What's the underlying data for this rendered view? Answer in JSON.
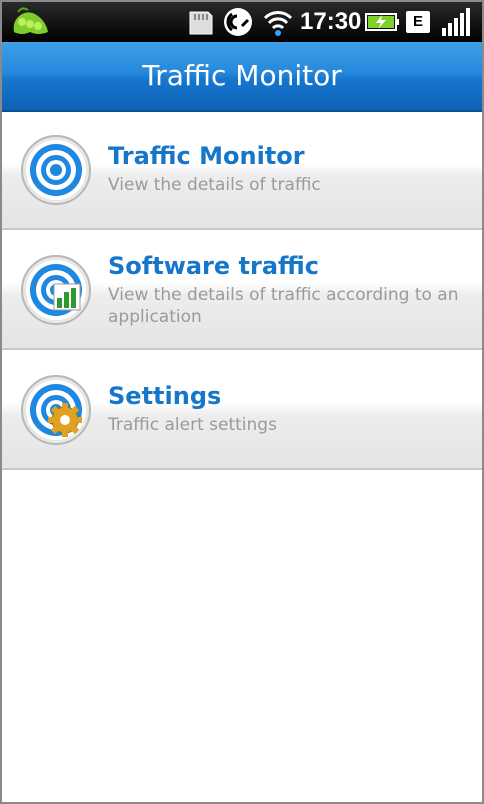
{
  "status_bar": {
    "time": "17:30",
    "network_type": "E",
    "icons": [
      "app-notification-icon",
      "sd-card-icon",
      "nfc-icon",
      "wifi-icon",
      "battery-charging-icon",
      "signal-bars-icon"
    ]
  },
  "title_bar": {
    "title": "Traffic Monitor"
  },
  "menu": {
    "items": [
      {
        "title": "Traffic Monitor",
        "subtitle": "View the details of traffic",
        "icon": "target-icon"
      },
      {
        "title": "Software traffic",
        "subtitle": "View the details of traffic according to an application",
        "icon": "target-chart-icon"
      },
      {
        "title": "Settings",
        "subtitle": "Traffic alert settings",
        "icon": "target-gear-icon"
      }
    ]
  },
  "colors": {
    "title_bar": "#1a7ed4",
    "item_title": "#1676c9",
    "item_subtitle": "#9a9a9a",
    "status_bar": "#000000"
  }
}
